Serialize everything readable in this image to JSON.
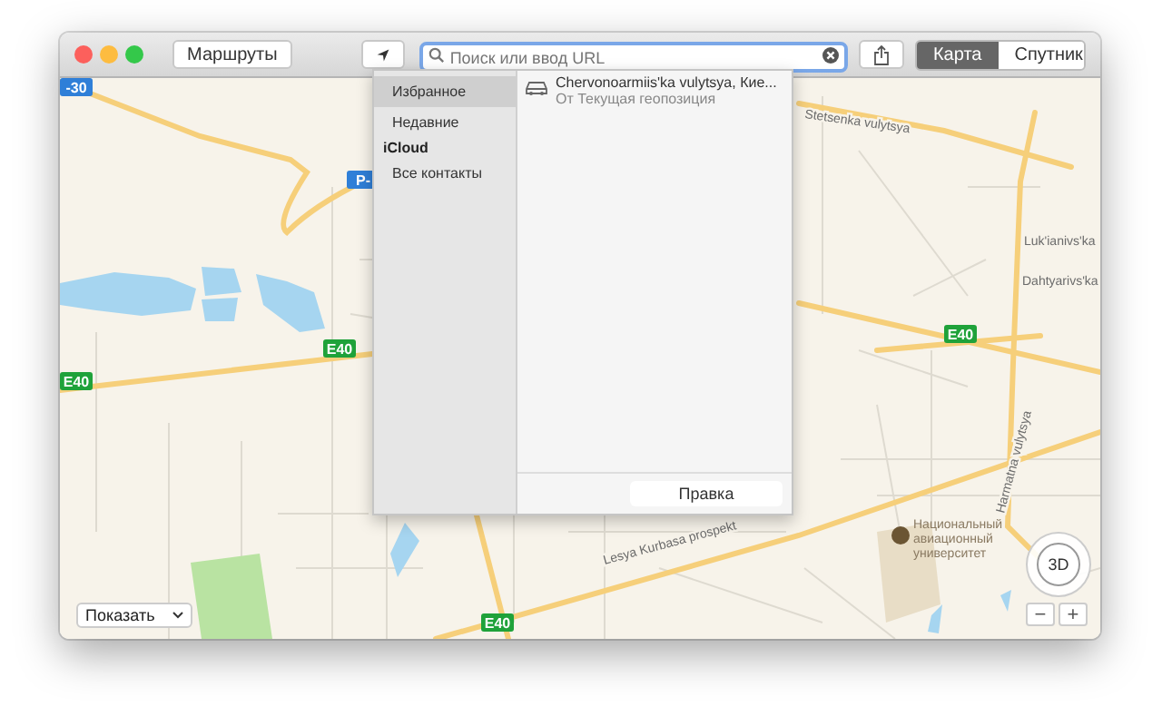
{
  "toolbar": {
    "directions_button": "Маршруты",
    "search": {
      "placeholder": "Поиск или ввод URL"
    },
    "map_modes": [
      {
        "label": "Карта",
        "selected": true
      },
      {
        "label": "Спутник",
        "selected": false
      }
    ]
  },
  "popover": {
    "sidebar": [
      {
        "label": "Избранное",
        "kind": "item",
        "selected": true
      },
      {
        "label": "Недавние",
        "kind": "item",
        "selected": false
      },
      {
        "label": "iCloud",
        "kind": "header"
      },
      {
        "label": "Все контакты",
        "kind": "item",
        "selected": false
      }
    ],
    "results": [
      {
        "title": "Chervonoarmiis'ka vulytsya, Кие...",
        "subtitle": "От Текущая геопозиция"
      }
    ],
    "edit_button": "Правка"
  },
  "map": {
    "shields": [
      {
        "label": "-30",
        "kind": "blue"
      },
      {
        "label": "P-",
        "kind": "blue"
      },
      {
        "label": "E40",
        "kind": "green"
      },
      {
        "label": "E40",
        "kind": "green"
      },
      {
        "label": "E40",
        "kind": "green"
      },
      {
        "label": "E40",
        "kind": "green"
      }
    ],
    "labels": [
      {
        "text": "Stetsenka vulytsya",
        "kind": "street"
      },
      {
        "text": "Luk'ianivs'ka",
        "kind": "street"
      },
      {
        "text": "Dahtyarivs'ka",
        "kind": "street"
      },
      {
        "text": "Lesya Kurbasa prospekt",
        "kind": "street"
      },
      {
        "text": "Harmatna vulytsya",
        "kind": "street"
      },
      {
        "text": "Национальный авиационный университет",
        "kind": "place"
      }
    ]
  },
  "show_menu": "Показать",
  "compass": "3D",
  "zoom_buttons": [
    "−",
    "+"
  ]
}
